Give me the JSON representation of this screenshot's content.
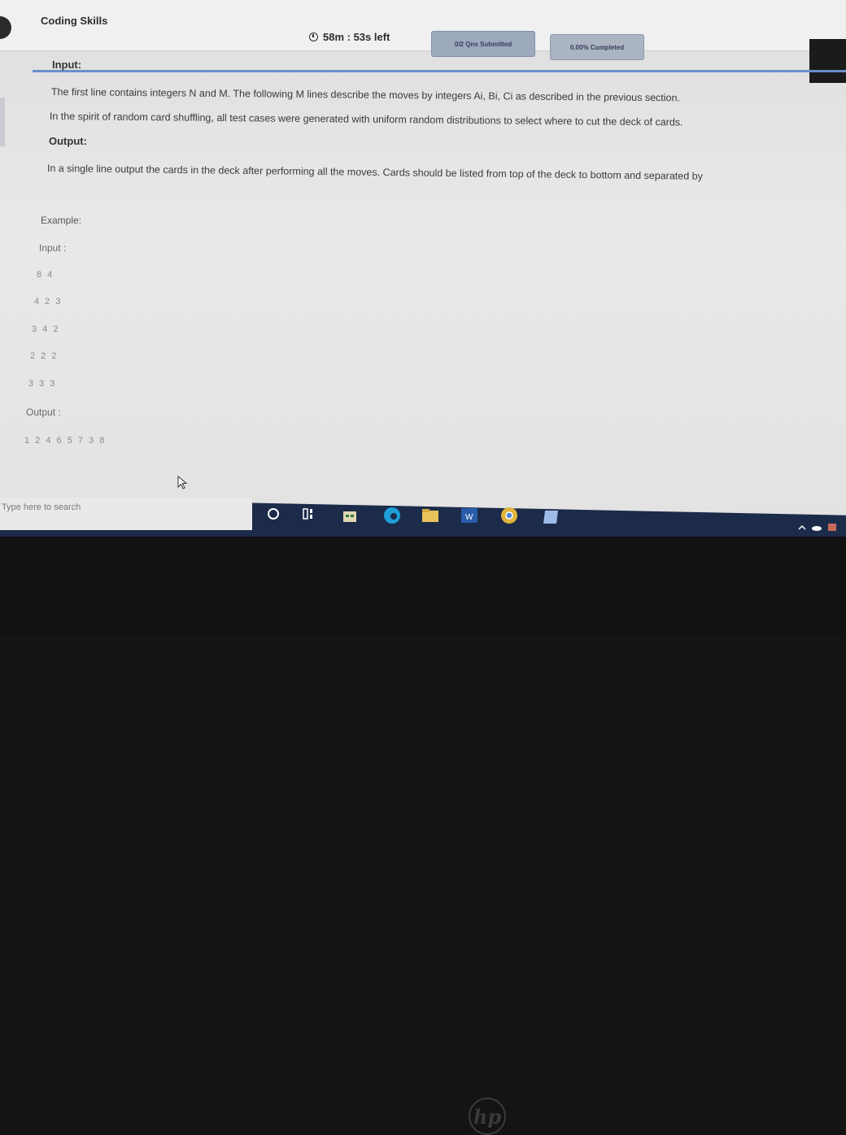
{
  "header": {
    "app_title": "Coding Skills",
    "timer": "58m : 53s  left",
    "submitted": "0/2 Qns Submitted",
    "completed": "0.00% Completed"
  },
  "problem": {
    "input_heading": "Input:",
    "input_line1": "The first line contains integers N and M. The following M lines describe the moves by integers Ai, Bi, Ci as described in the previous section.",
    "input_line2": "In the spirit of random card shuffling, all test cases were generated with uniform random distributions to select where to cut the deck of cards.",
    "output_heading": "Output:",
    "output_line": "In a single line output the cards in the deck after performing all the moves. Cards should be listed from top of the deck to bottom and separated by",
    "example_heading": "Example:",
    "example_input_label": "Input :",
    "example_input_lines": [
      "8 4",
      "4 2 3",
      "3 4 2",
      "2 2 2",
      "3 3 3"
    ],
    "example_output_label": "Output :",
    "example_output_value": "1 2 4 6 5 7 3 8"
  },
  "taskbar": {
    "search_placeholder": "Type here to search",
    "icons": [
      "cortana-icon",
      "task-view-icon",
      "store-icon",
      "edge-icon",
      "file-explorer-icon",
      "word-icon",
      "chrome-icon",
      "notes-icon"
    ]
  },
  "device": {
    "brand": "hp"
  }
}
